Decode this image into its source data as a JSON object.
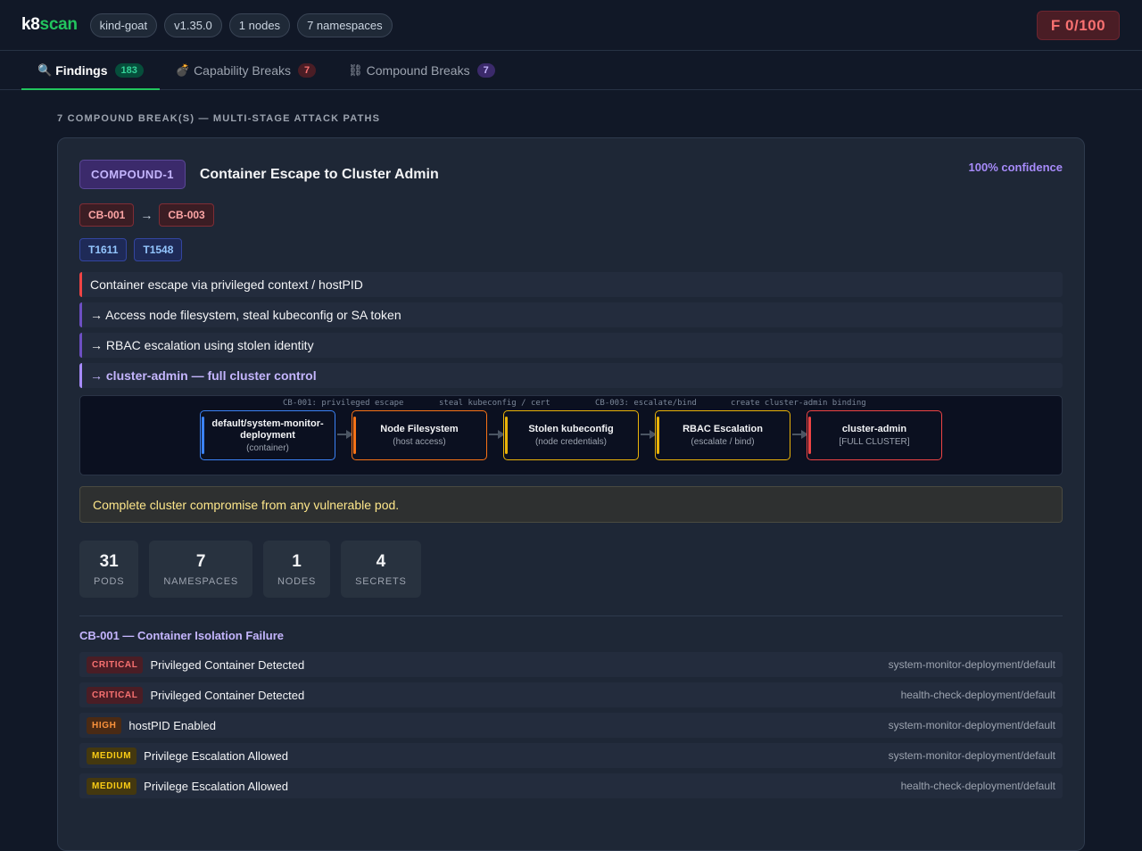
{
  "header": {
    "brand_a": "k8",
    "brand_b": "scan",
    "pills": [
      "kind-goat",
      "v1.35.0",
      "1 nodes",
      "7 namespaces"
    ],
    "score": "F 0/100"
  },
  "tabs": [
    {
      "icon": "🔍",
      "label": "Findings",
      "count": "183"
    },
    {
      "icon": "💣",
      "label": "Capability Breaks",
      "count": "7"
    },
    {
      "icon": "⛓",
      "label": "Compound Breaks",
      "count": "7"
    }
  ],
  "section_title": "7 COMPOUND BREAK(S) — MULTI-STAGE ATTACK PATHS",
  "compound": {
    "id": "COMPOUND-1",
    "title": "Container Escape to Cluster Admin",
    "confidence": "100% confidence",
    "chain": [
      "CB-001",
      "CB-003"
    ],
    "chain_arrow": "→",
    "techniques": [
      "T1611",
      "T1548"
    ],
    "steps": [
      "Container escape via privileged context / hostPID",
      "→ Access node filesystem, steal kubeconfig or SA token",
      "→ RBAC escalation using stolen identity",
      "→ cluster-admin — full cluster control"
    ],
    "flow": {
      "edge_labels": [
        "CB-001: privileged escape",
        "steal kubeconfig / cert",
        "CB-003: escalate/bind",
        "create cluster-admin binding"
      ],
      "nodes": [
        {
          "title": "default/system-monitor-deployment",
          "sub": "(container)",
          "color": "#3b82f6"
        },
        {
          "title": "Node Filesystem",
          "sub": "(host access)",
          "color": "#f97316"
        },
        {
          "title": "Stolen kubeconfig",
          "sub": "(node credentials)",
          "color": "#eab308"
        },
        {
          "title": "RBAC Escalation",
          "sub": "(escalate / bind)",
          "color": "#eab308"
        },
        {
          "title": "cluster-admin",
          "sub": "[FULL CLUSTER]",
          "color": "#ef4444"
        }
      ]
    },
    "impact": "Complete cluster compromise from any vulnerable pod.",
    "stats": [
      {
        "num": "31",
        "label": "PODS"
      },
      {
        "num": "7",
        "label": "NAMESPACES"
      },
      {
        "num": "1",
        "label": "NODES"
      },
      {
        "num": "4",
        "label": "SECRETS"
      }
    ],
    "cb_section_title": "CB-001 — Container Isolation Failure",
    "findings": [
      {
        "severity": "CRITICAL",
        "title": "Privileged Container Detected",
        "resource": "system-monitor-deployment/default"
      },
      {
        "severity": "CRITICAL",
        "title": "Privileged Container Detected",
        "resource": "health-check-deployment/default"
      },
      {
        "severity": "HIGH",
        "title": "hostPID Enabled",
        "resource": "system-monitor-deployment/default"
      },
      {
        "severity": "MEDIUM",
        "title": "Privilege Escalation Allowed",
        "resource": "system-monitor-deployment/default"
      },
      {
        "severity": "MEDIUM",
        "title": "Privilege Escalation Allowed",
        "resource": "health-check-deployment/default"
      }
    ]
  }
}
